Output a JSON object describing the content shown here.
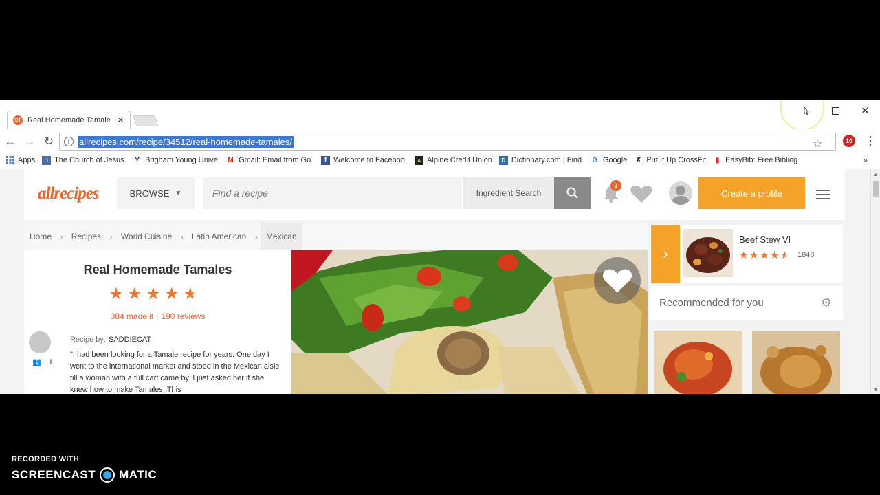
{
  "browser": {
    "tab_title": "Real Homemade Tamale",
    "tab_favicon": "OT",
    "url": "allrecipes.com/recipe/34512/real-homemade-tamales/",
    "bookmarks": [
      {
        "label": "Apps",
        "icon": "apps-grid-icon"
      },
      {
        "label": "The Church of Jesus C",
        "icon": "church-icon"
      },
      {
        "label": "Brigham Young Unive",
        "icon": "byu-icon"
      },
      {
        "label": "Gmail: Email from Go",
        "icon": "gmail-icon"
      },
      {
        "label": "Welcome to Faceboo",
        "icon": "facebook-icon"
      },
      {
        "label": "Alpine Credit Union",
        "icon": "alpine-icon"
      },
      {
        "label": "Dictionary.com | Find",
        "icon": "dictionary-icon"
      },
      {
        "label": "Google",
        "icon": "google-icon"
      },
      {
        "label": "Put It Up CrossFit",
        "icon": "crossfit-icon"
      },
      {
        "label": "EasyBib: Free Bibliog",
        "icon": "easybib-icon"
      }
    ],
    "bookmarks_more": "»",
    "extension_badge": "10"
  },
  "header": {
    "logo": "allrecipes",
    "browse_label": "BROWSE",
    "search_placeholder": "Find a recipe",
    "ingredient_search_label": "Ingredient Search",
    "notification_count": "1",
    "create_profile_label": "Create a profile"
  },
  "breadcrumb": [
    "Home",
    "Recipes",
    "World Cuisine",
    "Latin American",
    "Mexican"
  ],
  "recipe": {
    "title": "Real Homemade Tamales",
    "rating": 4.5,
    "made_it": "384 made it",
    "reviews": "190 reviews",
    "recipe_by_label": "Recipe by:",
    "author": "SADDIECAT",
    "followers": "1",
    "description": "\"I had been looking for a Tamale recipe for years. One day I went to the international market and stood in the Mexican aisle till a woman with a full cart came by. I just asked her if she knew how to make Tamales. This"
  },
  "sidebar": {
    "next_title": "Beef Stew VI",
    "next_rating": 4.5,
    "next_count": "1848",
    "recommended_label": "Recommended for you"
  },
  "screencast": {
    "recorded_with": "RECORDED WITH",
    "brand_left": "SCREENCAST",
    "brand_right": "MATIC"
  },
  "colors": {
    "brand_orange": "#e8662b",
    "accent_yellow": "#f4a228",
    "url_highlight": "#3a78d8"
  }
}
